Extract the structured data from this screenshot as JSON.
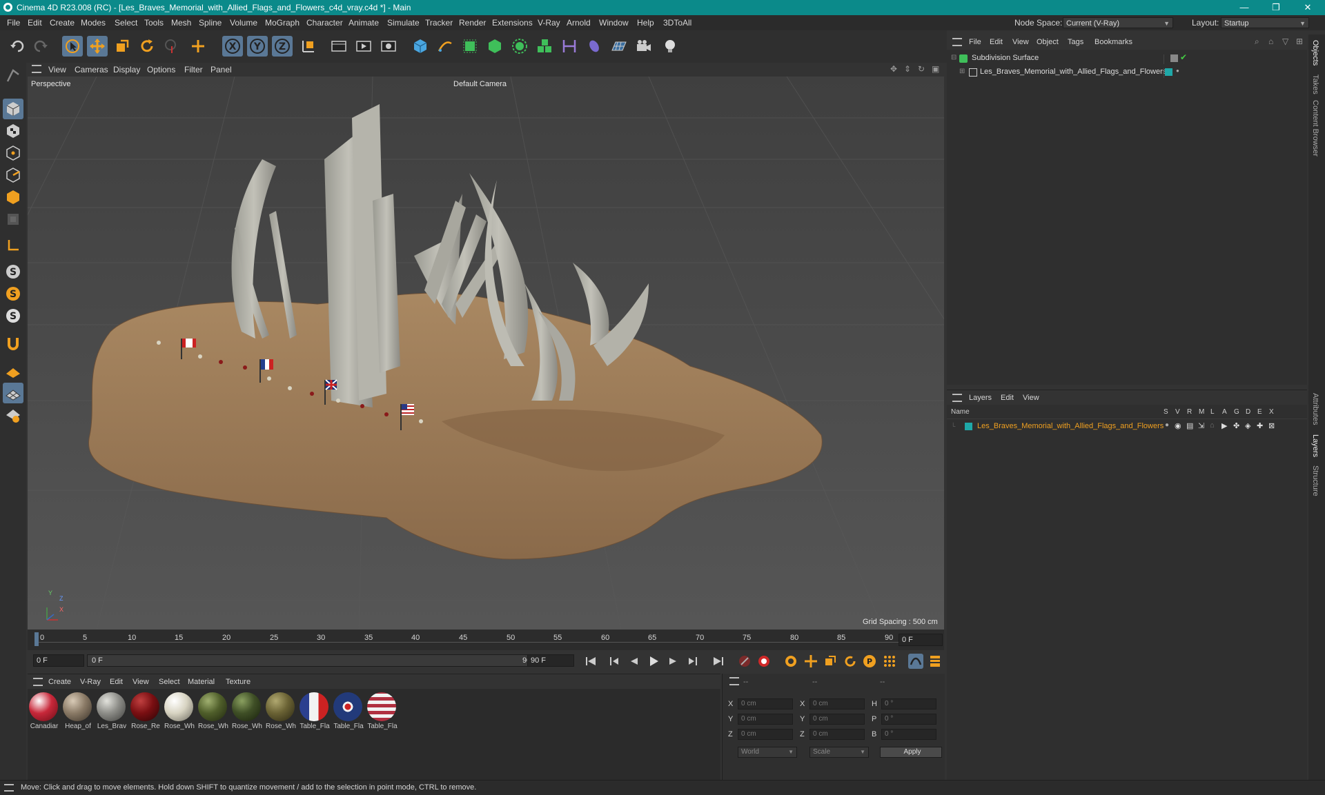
{
  "window": {
    "title": "Cinema 4D R23.008 (RC) - [Les_Braves_Memorial_with_Allied_Flags_and_Flowers_c4d_vray.c4d *] - Main",
    "minimize": "—",
    "maximize": "❐",
    "close": "✕"
  },
  "menubar": {
    "items": [
      "File",
      "Edit",
      "Create",
      "Modes",
      "Select",
      "Tools",
      "Mesh",
      "Spline",
      "Volume",
      "MoGraph",
      "Character",
      "Animate",
      "Simulate",
      "Tracker",
      "Render",
      "Extensions",
      "V-Ray",
      "Arnold",
      "Window",
      "Help",
      "3DToAll"
    ],
    "node_space_label": "Node Space:",
    "node_space_value": "Current (V-Ray)",
    "layout_label": "Layout:",
    "layout_value": "Startup"
  },
  "viewport": {
    "menu": [
      "View",
      "Cameras",
      "Display",
      "Options",
      "Filter",
      "Panel"
    ],
    "projection": "Perspective",
    "camera": "Default Camera",
    "grid_spacing": "Grid Spacing : 500 cm",
    "axis_y": "Y",
    "axis_z": "Z",
    "axis_x": "X"
  },
  "timeline": {
    "ticks": [
      "0",
      "5",
      "10",
      "15",
      "20",
      "25",
      "30",
      "35",
      "40",
      "45",
      "50",
      "55",
      "60",
      "65",
      "70",
      "75",
      "80",
      "85",
      "90"
    ],
    "current_frame_right": "0 F",
    "start_frame": "0 F",
    "range_start": "0 F",
    "range_end": "90 F",
    "end_frame": "90 F"
  },
  "materials": {
    "menu": [
      "Create",
      "V-Ray",
      "Edit",
      "View",
      "Select",
      "Material",
      "Texture"
    ],
    "items": [
      {
        "name": "Canadiar",
        "color": "#c8283a"
      },
      {
        "name": "Heap_of",
        "color": "#8a7a66"
      },
      {
        "name": "Les_Brav",
        "color": "#8d8d88"
      },
      {
        "name": "Rose_Re",
        "color": "#7a0f12"
      },
      {
        "name": "Rose_Wh",
        "color": "#d8d4c2"
      },
      {
        "name": "Rose_Wh",
        "color": "#4f5e2a"
      },
      {
        "name": "Rose_Wh",
        "color": "#3f4f26"
      },
      {
        "name": "Rose_Wh",
        "color": "#6a6234"
      },
      {
        "name": "Table_Fla",
        "color": "#2b3f8f"
      },
      {
        "name": "Table_Fla",
        "color": "#223a7a"
      },
      {
        "name": "Table_Fla",
        "color": "#b03040"
      }
    ]
  },
  "coords": {
    "header": [
      "--",
      "--",
      "--"
    ],
    "rows": [
      {
        "l1": "X",
        "v1": "0 cm",
        "l2": "X",
        "v2": "0 cm",
        "l3": "H",
        "v3": "0 °"
      },
      {
        "l1": "Y",
        "v1": "0 cm",
        "l2": "Y",
        "v2": "0 cm",
        "l3": "P",
        "v3": "0 °"
      },
      {
        "l1": "Z",
        "v1": "0 cm",
        "l2": "Z",
        "v2": "0 cm",
        "l3": "B",
        "v3": "0 °"
      }
    ],
    "mode": "World",
    "size_mode": "Scale",
    "apply": "Apply"
  },
  "objects": {
    "menu": [
      "File",
      "Edit",
      "View",
      "Object",
      "Tags",
      "Bookmarks"
    ],
    "tree": [
      {
        "name": "Subdivision Surface",
        "color": "#5ec96b"
      },
      {
        "name": "Les_Braves_Memorial_with_Allied_Flags_and_Flowers",
        "color": "#1fa8a8"
      }
    ]
  },
  "layers": {
    "menu": [
      "Layers",
      "Edit",
      "View"
    ],
    "header_name": "Name",
    "columns": [
      "S",
      "V",
      "R",
      "M",
      "L",
      "A",
      "G",
      "D",
      "E",
      "X"
    ],
    "items": [
      {
        "name": "Les_Braves_Memorial_with_Allied_Flags_and_Flowers",
        "color": "#1fa8a8"
      }
    ]
  },
  "side_tabs": [
    "Objects",
    "Takes",
    "Content Browser",
    "Attributes",
    "Layers",
    "Structure"
  ],
  "status": "Move: Click and drag to move elements. Hold down SHIFT to quantize movement / add to the selection in point mode, CTRL to remove.",
  "colors": {
    "accent": "#0b8a8a",
    "selection": "#5a7896",
    "orange": "#f0a020",
    "layer_text": "#f0a020"
  }
}
